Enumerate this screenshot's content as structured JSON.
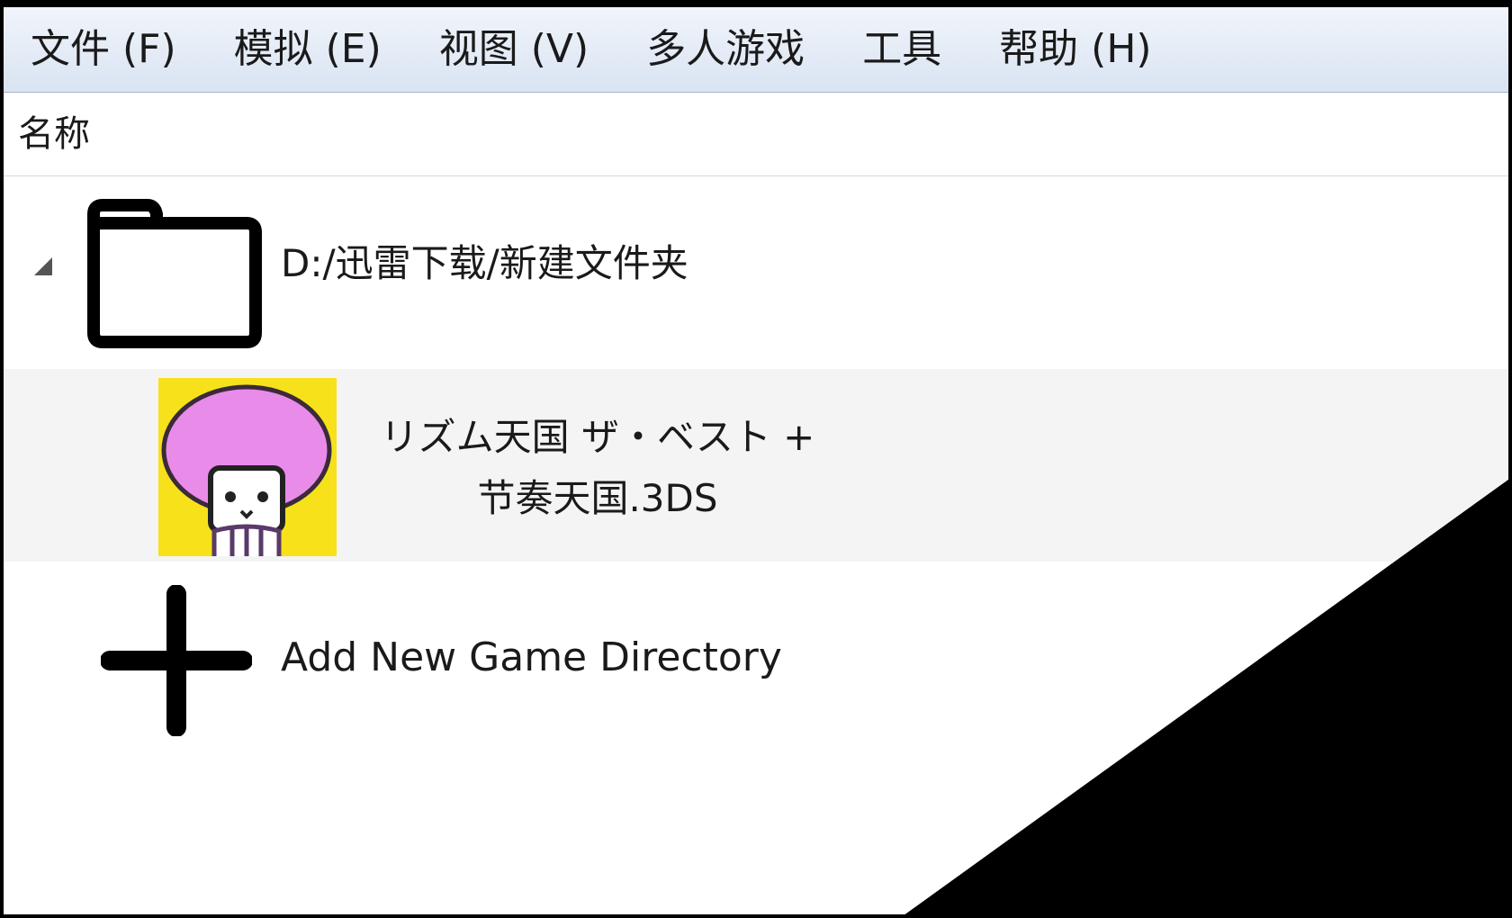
{
  "menubar": {
    "items": [
      {
        "label": "文件 (F)"
      },
      {
        "label": "模拟 (E)"
      },
      {
        "label": "视图 (V)"
      },
      {
        "label": "多人游戏"
      },
      {
        "label": "工具"
      },
      {
        "label": "帮助 (H)"
      }
    ]
  },
  "list": {
    "header": {
      "name_column": "名称"
    },
    "directory": {
      "path": "D:/迅雷下载/新建文件夹",
      "icon": "folder-icon",
      "expanded": true
    },
    "games": [
      {
        "title_line1": "リズム天国 ザ・ベスト +",
        "title_line2": "节奏天国.3DS",
        "icon": "game-cover-icon"
      }
    ],
    "add_directory": {
      "label": "Add New Game Directory",
      "icon": "plus-icon"
    }
  },
  "colors": {
    "menubar_top": "#f1f5fb",
    "menubar_bottom": "#d9e3f2",
    "game_row_bg": "#f4f4f4",
    "cover_bg": "#f7e11a",
    "cover_hair": "#e98be8"
  }
}
